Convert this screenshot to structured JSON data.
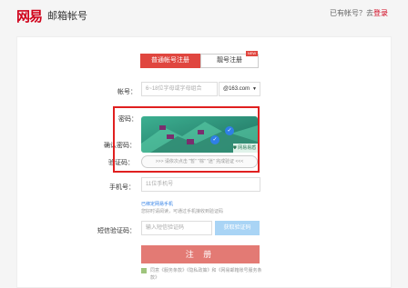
{
  "header": {
    "logo": "网易",
    "product": "邮箱帐号",
    "login_prompt": "已有帐号？去",
    "login_link": "登录"
  },
  "tabs": {
    "primary": "普通帐号注册",
    "secondary": "靓号注册",
    "badge": "NEW"
  },
  "form": {
    "account_label": "帐号：",
    "account_placeholder": "6~18位字母或字母组合",
    "domain": "@163.com",
    "password_label": "密码：",
    "confirm_label": "确认密码：",
    "captcha_label": "验证码：",
    "captcha_tip": ">>> 请依次点击 \"暂\" \"棕\" \"迷\" 完成验证 <<<",
    "captcha_brand": "网易易盾",
    "phone_label": "手机号：",
    "phone_placeholder": "11位手机号",
    "phone_hint_1": "已绑定网易手机",
    "phone_hint_2": "您好时请阅读，可通过手机接收到验证码",
    "sms_label": "短信验证码：",
    "sms_placeholder": "输入短信验证码",
    "send_code": "获取验证码",
    "submit": "注 册",
    "agree": "同意《服务条款》《隐私政策》和《网易邮箱账号服务条款》"
  },
  "colors": {
    "brand": "#d0021b",
    "primary_tab": "#e0463f",
    "submit": "#e37a74",
    "send_code": "#a9d4f5",
    "highlight": "#e02020"
  },
  "icons": {
    "dropdown": "chevron-down-icon",
    "check": "check-circle-icon",
    "shield": "shield-icon"
  }
}
